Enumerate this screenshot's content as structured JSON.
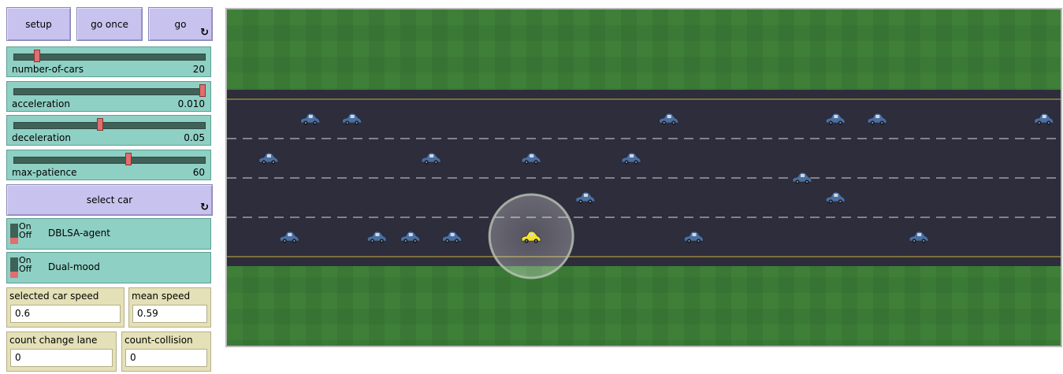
{
  "buttons": {
    "setup": "setup",
    "go_once": "go once",
    "go": "go",
    "select_car": "select car"
  },
  "sliders": [
    {
      "name": "number-of-cars",
      "value": "20",
      "fraction": 0.11
    },
    {
      "name": "acceleration",
      "value": "0.010",
      "fraction": 1.0
    },
    {
      "name": "deceleration",
      "value": "0.05",
      "fraction": 0.45
    },
    {
      "name": "max-patience",
      "value": "60",
      "fraction": 0.6
    }
  ],
  "switches": [
    {
      "name": "DBLSA-agent",
      "on_label": "On",
      "off_label": "Off",
      "state": "off"
    },
    {
      "name": "Dual-mood",
      "on_label": "On",
      "off_label": "Off",
      "state": "off"
    }
  ],
  "monitors": {
    "selected_car_speed": {
      "name": "selected car speed",
      "value": "0.6"
    },
    "mean_speed": {
      "name": "mean speed",
      "value": "0.59"
    },
    "count_change_lane": {
      "name": "count change lane",
      "value": "0"
    },
    "count_collision": {
      "name": "count-collision",
      "value": "0"
    }
  },
  "icons": {
    "forever": "forever-arrows-icon"
  },
  "colors": {
    "button": "#c8c2ee",
    "widget": "#8fd0c4",
    "monitor": "#e4e0b7",
    "grass": "#3b7a36",
    "road": "#2e2d3c",
    "edge_line": "#c9b23a",
    "lane_dash": "#d7d7e0",
    "car": "#4a6fa0",
    "selected_car": "#f4e22a"
  },
  "world": {
    "lanes": 4,
    "cars": [
      {
        "lane": 0,
        "pos": 0.1
      },
      {
        "lane": 0,
        "pos": 0.15
      },
      {
        "lane": 0,
        "pos": 0.53
      },
      {
        "lane": 0,
        "pos": 0.73
      },
      {
        "lane": 0,
        "pos": 0.78
      },
      {
        "lane": 0,
        "pos": 0.98
      },
      {
        "lane": 1,
        "pos": 0.05
      },
      {
        "lane": 1,
        "pos": 0.245
      },
      {
        "lane": 1,
        "pos": 0.365
      },
      {
        "lane": 1,
        "pos": 0.485
      },
      {
        "lane": 1.5,
        "pos": 0.69
      },
      {
        "lane": 2,
        "pos": 0.43
      },
      {
        "lane": 2,
        "pos": 0.73
      },
      {
        "lane": 3,
        "pos": 0.075
      },
      {
        "lane": 3,
        "pos": 0.18
      },
      {
        "lane": 3,
        "pos": 0.22
      },
      {
        "lane": 3,
        "pos": 0.27
      },
      {
        "lane": 3,
        "pos": 0.56
      },
      {
        "lane": 3,
        "pos": 0.83
      },
      {
        "lane": 3,
        "pos": 0.365,
        "selected": true
      }
    ]
  }
}
